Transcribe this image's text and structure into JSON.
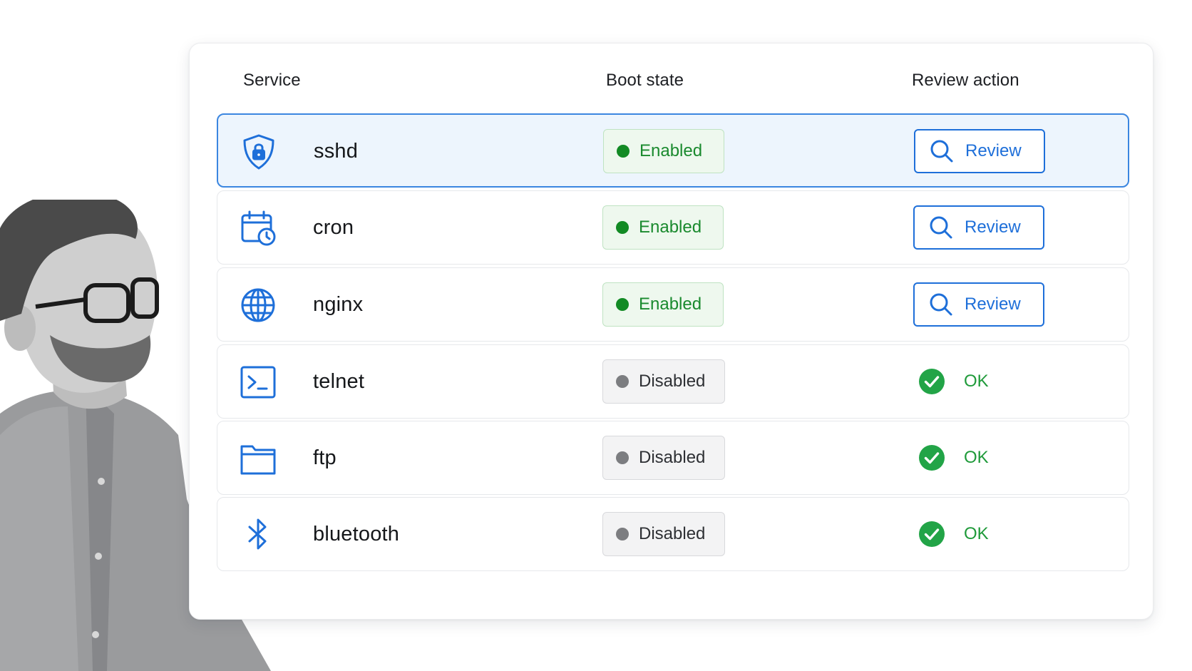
{
  "table": {
    "headers": {
      "service": "Service",
      "boot_state": "Boot state",
      "review_action": "Review action"
    },
    "rows": [
      {
        "service": "sshd",
        "icon": "shield-lock-icon",
        "state": "Enabled",
        "action": "Review",
        "selected": true
      },
      {
        "service": "cron",
        "icon": "calendar-clock-icon",
        "state": "Enabled",
        "action": "Review",
        "selected": false
      },
      {
        "service": "nginx",
        "icon": "globe-icon",
        "state": "Enabled",
        "action": "Review",
        "selected": false
      },
      {
        "service": "telnet",
        "icon": "terminal-icon",
        "state": "Disabled",
        "action": "OK",
        "selected": false
      },
      {
        "service": "ftp",
        "icon": "folder-icon",
        "state": "Disabled",
        "action": "OK",
        "selected": false
      },
      {
        "service": "bluetooth",
        "icon": "bluetooth-icon",
        "state": "Disabled",
        "action": "OK",
        "selected": false
      }
    ]
  },
  "colors": {
    "accent_blue": "#1e6fd9",
    "selected_row_bg": "#edf5fd",
    "enabled_green": "#1a8a2e",
    "ok_green": "#1f9a3a",
    "disabled_gray": "#7c7d80"
  }
}
